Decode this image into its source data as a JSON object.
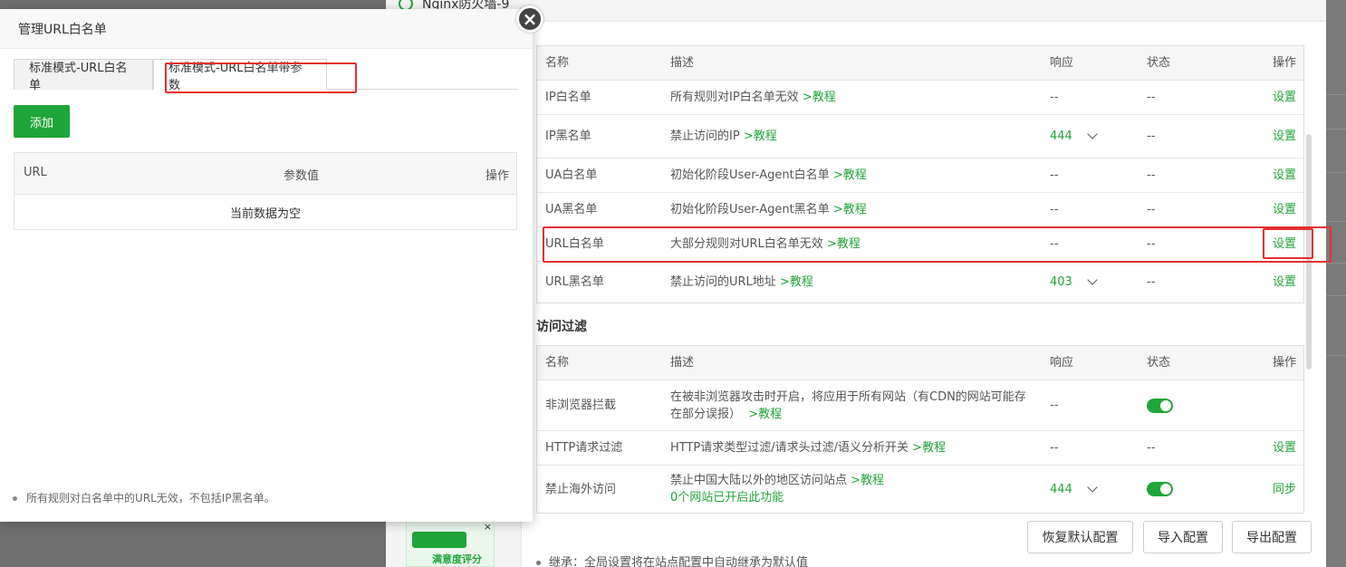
{
  "panel": {
    "title": "Nginx防火墙-9",
    "table1": {
      "headers": {
        "name": "名称",
        "desc": "描述",
        "resp": "响应",
        "state": "状态",
        "op": "操作"
      },
      "rows": [
        {
          "name": "IP白名单",
          "desc": "所有规则对IP白名单无效",
          "link": ">教程",
          "resp": "--",
          "state": "--",
          "op": "设置"
        },
        {
          "name": "IP黑名单",
          "desc": "禁止访问的IP",
          "link": ">教程",
          "resp": "444",
          "state": "--",
          "op": "设置"
        },
        {
          "name": "UA白名单",
          "desc": "初始化阶段User-Agent白名单",
          "link": ">教程",
          "resp": "--",
          "state": "--",
          "op": "设置"
        },
        {
          "name": "UA黑名单",
          "desc": "初始化阶段User-Agent黑名单",
          "link": ">教程",
          "resp": "--",
          "state": "--",
          "op": "设置"
        },
        {
          "name": "URL白名单",
          "desc": "大部分规则对URL白名单无效",
          "link": ">教程",
          "resp": "--",
          "state": "--",
          "op": "设置"
        },
        {
          "name": "URL黑名单",
          "desc": "禁止访问的URL地址",
          "link": ">教程",
          "resp": "403",
          "state": "--",
          "op": "设置"
        }
      ]
    },
    "section2_title": "访问过滤",
    "table2": {
      "headers": {
        "name": "名称",
        "desc": "描述",
        "resp": "响应",
        "state": "状态",
        "op": "操作"
      },
      "rows": [
        {
          "name": "非浏览器拦截",
          "desc_line1": "在被非浏览器攻击时开启，将应用于所有网站（有CDN的网站可能存",
          "desc_line2": "在部分误报）",
          "link": ">教程",
          "resp": "--",
          "op": ""
        },
        {
          "name": "HTTP请求过滤",
          "desc": "HTTP请求类型过滤/请求头过滤/语义分析开关",
          "link": ">教程",
          "resp": "--",
          "state": "--",
          "op": "设置"
        },
        {
          "name": "禁止海外访问",
          "desc": "禁止中国大陆以外的地区访问站点",
          "link": ">教程",
          "desc_line2": "0个网站已开启此功能",
          "resp": "444",
          "op": "同步"
        }
      ]
    },
    "buttons": {
      "restore": "恢复默认配置",
      "import": "导入配置",
      "export": "导出配置"
    },
    "footnote": "继承：全局设置将在站点配置中自动继承为默认值",
    "promo_label": "满意度评分",
    "promo_close": "×"
  },
  "modal": {
    "title": "管理URL白名单",
    "close": "×",
    "tabs": [
      "标准模式-URL白名单",
      "标准模式-URL白名单带参数"
    ],
    "add_button": "添加",
    "table_headers": {
      "url": "URL",
      "param": "参数值",
      "op": "操作"
    },
    "empty_text": "当前数据为空",
    "note": "所有规则对白名单中的URL无效，不包括IP黑名单。"
  },
  "colors": {
    "accent": "#20a53a",
    "annotation": "#e53030"
  }
}
